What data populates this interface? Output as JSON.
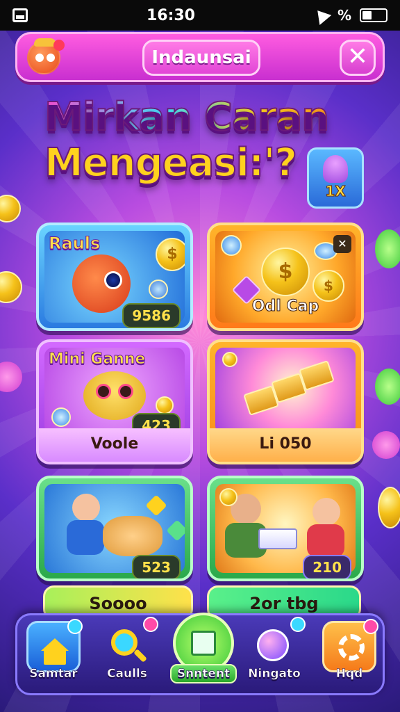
{
  "status_bar": {
    "time": "16:30",
    "signal_text": "%"
  },
  "header": {
    "title": "Indaunsai",
    "close_label": "✕"
  },
  "headline": {
    "line1": "Mirkan Caran",
    "line2": "Mengeasi:'?"
  },
  "reward_chip": {
    "label": "1X"
  },
  "cards": [
    {
      "title": "Rauls",
      "value": "9586"
    },
    {
      "label": "Odl Cap"
    },
    {
      "title": "Mini Ganne",
      "value": "423",
      "label": "Voole"
    },
    {
      "label": "Li 050"
    },
    {
      "value": "523"
    },
    {
      "value": "210"
    }
  ],
  "sub_buttons": [
    "Soooo",
    "2or tbg"
  ],
  "nav": [
    {
      "label": "Samtar",
      "icon": "home-icon"
    },
    {
      "label": "Caulls",
      "icon": "search-icon"
    },
    {
      "label": "Snntent",
      "icon": "leaf-icon"
    },
    {
      "label": "Ningato",
      "icon": "chat-bubble-icon"
    },
    {
      "label": "Hqd",
      "icon": "gear-icon"
    }
  ],
  "colors": {
    "accent_pink": "#ff5ce0",
    "headline_yellow": "#ffd21e",
    "nav_bg": "#2a1a7a"
  }
}
